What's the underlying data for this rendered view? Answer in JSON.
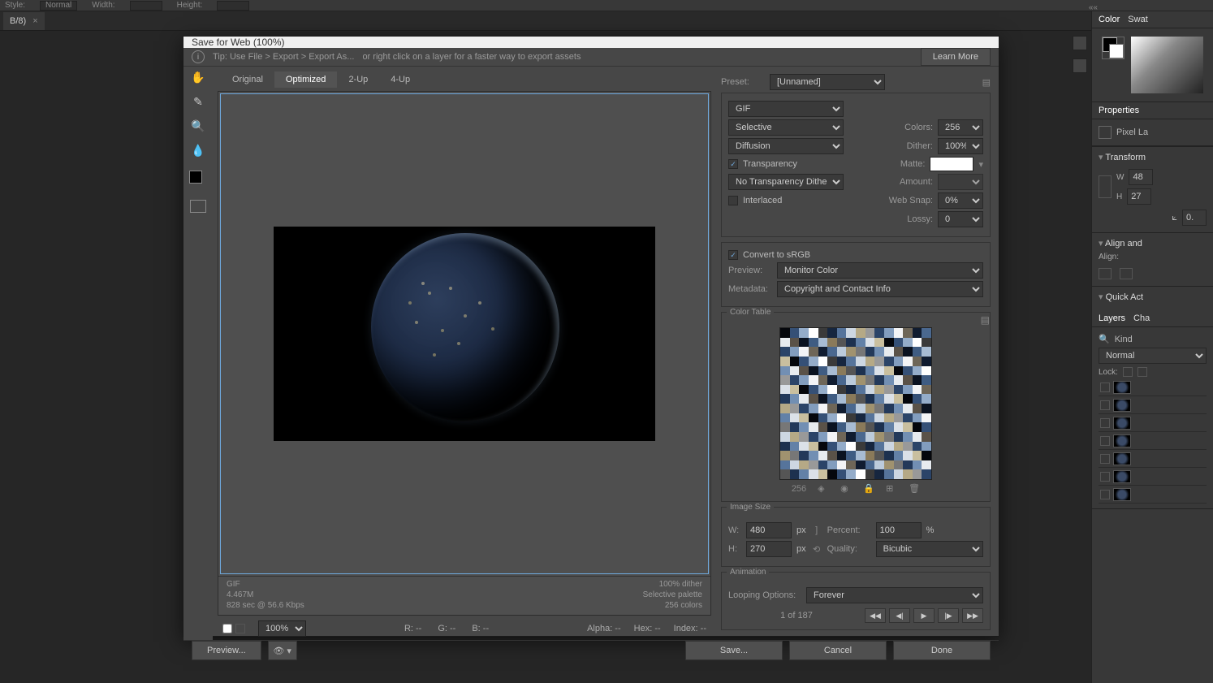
{
  "topbar": {
    "style_label": "Style:",
    "style_value": "Normal",
    "width_label": "Width:",
    "height_label": "Height:"
  },
  "doctab": {
    "name": "B/8)",
    "close": "×"
  },
  "dialog": {
    "title": "Save for Web (100%)",
    "tip_prefix": "Tip: Use File > Export > Export As...",
    "tip_suffix": "or right click on a layer for a faster way to export assets",
    "learn_more": "Learn More",
    "tabs": {
      "original": "Original",
      "optimized": "Optimized",
      "twoup": "2-Up",
      "fourup": "4-Up"
    },
    "status": {
      "format": "GIF",
      "size": "4.467M",
      "time": "828 sec @ 56.6 Kbps",
      "dither": "100% dither",
      "palette": "Selective palette",
      "colors": "256 colors"
    },
    "readout": {
      "zoom": "100%",
      "r": "R: --",
      "g": "G: --",
      "b": "B: --",
      "alpha": "Alpha: --",
      "hex": "Hex: --",
      "index": "Index: --"
    },
    "footer": {
      "preview": "Preview...",
      "save": "Save...",
      "cancel": "Cancel",
      "done": "Done"
    }
  },
  "settings": {
    "preset_label": "Preset:",
    "preset_value": "[Unnamed]",
    "format": "GIF",
    "reduction": "Selective",
    "colors_label": "Colors:",
    "colors_value": "256",
    "dither_method": "Diffusion",
    "dither_label": "Dither:",
    "dither_value": "100%",
    "transparency_label": "Transparency",
    "matte_label": "Matte:",
    "trans_dither": "No Transparency Dither",
    "amount_label": "Amount:",
    "interlaced_label": "Interlaced",
    "websnap_label": "Web Snap:",
    "websnap_value": "0%",
    "lossy_label": "Lossy:",
    "lossy_value": "0",
    "srgb_label": "Convert to sRGB",
    "preview_label": "Preview:",
    "preview_value": "Monitor Color",
    "metadata_label": "Metadata:",
    "metadata_value": "Copyright and Contact Info",
    "colortable_label": "Color Table",
    "ct_count": "256",
    "imagesize_label": "Image Size",
    "w_label": "W:",
    "w_value": "480",
    "h_label": "H:",
    "h_value": "270",
    "px": "px",
    "percent_label": "Percent:",
    "percent_value": "100",
    "pct": "%",
    "quality_label": "Quality:",
    "quality_value": "Bicubic",
    "animation_label": "Animation",
    "loop_label": "Looping Options:",
    "loop_value": "Forever",
    "frame": "1 of 187"
  },
  "rightpanels": {
    "color_tab": "Color",
    "swat_tab": "Swat",
    "properties": "Properties",
    "pixel": "Pixel La",
    "transform": "Transform",
    "w": "W",
    "wval": "48",
    "h": "H",
    "hval": "27",
    "angle": "0.",
    "align": "Align and",
    "align_label": "Align:",
    "quick": "Quick Act",
    "layers": "Layers",
    "cha": "Cha",
    "kind": "Kind",
    "normal": "Normal",
    "lock": "Lock:"
  }
}
